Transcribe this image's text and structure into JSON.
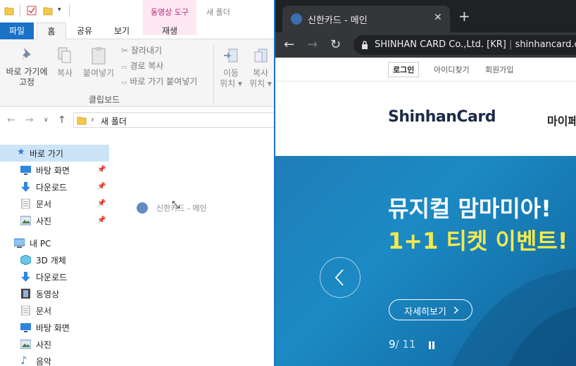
{
  "explorer": {
    "contextual_tab_header": "동영상 도구",
    "window_title": "새 폴더",
    "tabs": {
      "file": "파일",
      "home": "홈",
      "share": "공유",
      "view": "보기",
      "play": "재생"
    },
    "ribbon": {
      "pin_quick_access": [
        "바로 가기에",
        "고정"
      ],
      "copy": "복사",
      "paste": "붙여넣기",
      "cut": "잘라내기",
      "copy_path": "경로 복사",
      "paste_shortcut": "바로 가기 붙여넣기",
      "clipboard_group": "클립보드",
      "move_to": [
        "이동",
        "위치 ▾"
      ],
      "copy_to": [
        "복사",
        "위치 ▾"
      ]
    },
    "address": {
      "path": "새 폴더"
    },
    "nav": {
      "quick_access": "바로 가기",
      "desktop": "바탕 화면",
      "downloads": "다운로드",
      "documents": "문서",
      "pictures": "사진",
      "this_pc": "내 PC",
      "objects_3d": "3D 개체",
      "downloads2": "다운로드",
      "videos": "동영상",
      "documents2": "문서",
      "desktop2": "바탕 화면",
      "pictures2": "사진",
      "music": "음악"
    },
    "drag_ghost": "신한카드 - 메인"
  },
  "browser": {
    "tab_title": "신한카드 - 메인",
    "url_org": "SHINHAN CARD Co.,Ltd. [KR]",
    "url_domain": "shinhancard.c",
    "topbar": {
      "login": "로그인",
      "find_id": "아이디찾기",
      "join": "회원가입"
    },
    "logo": "ShinhanCard",
    "menu_partial": "마이페",
    "banner": {
      "line1": "뮤지컬 맘마미아!",
      "line2": "1+1 티켓 이벤트!",
      "more": "자세히보기",
      "current": "9",
      "total": "/ 11"
    }
  },
  "colors": {
    "accent": "#1a72c6",
    "banner": "#1c8ac4",
    "highlight": "#f2e94e"
  }
}
